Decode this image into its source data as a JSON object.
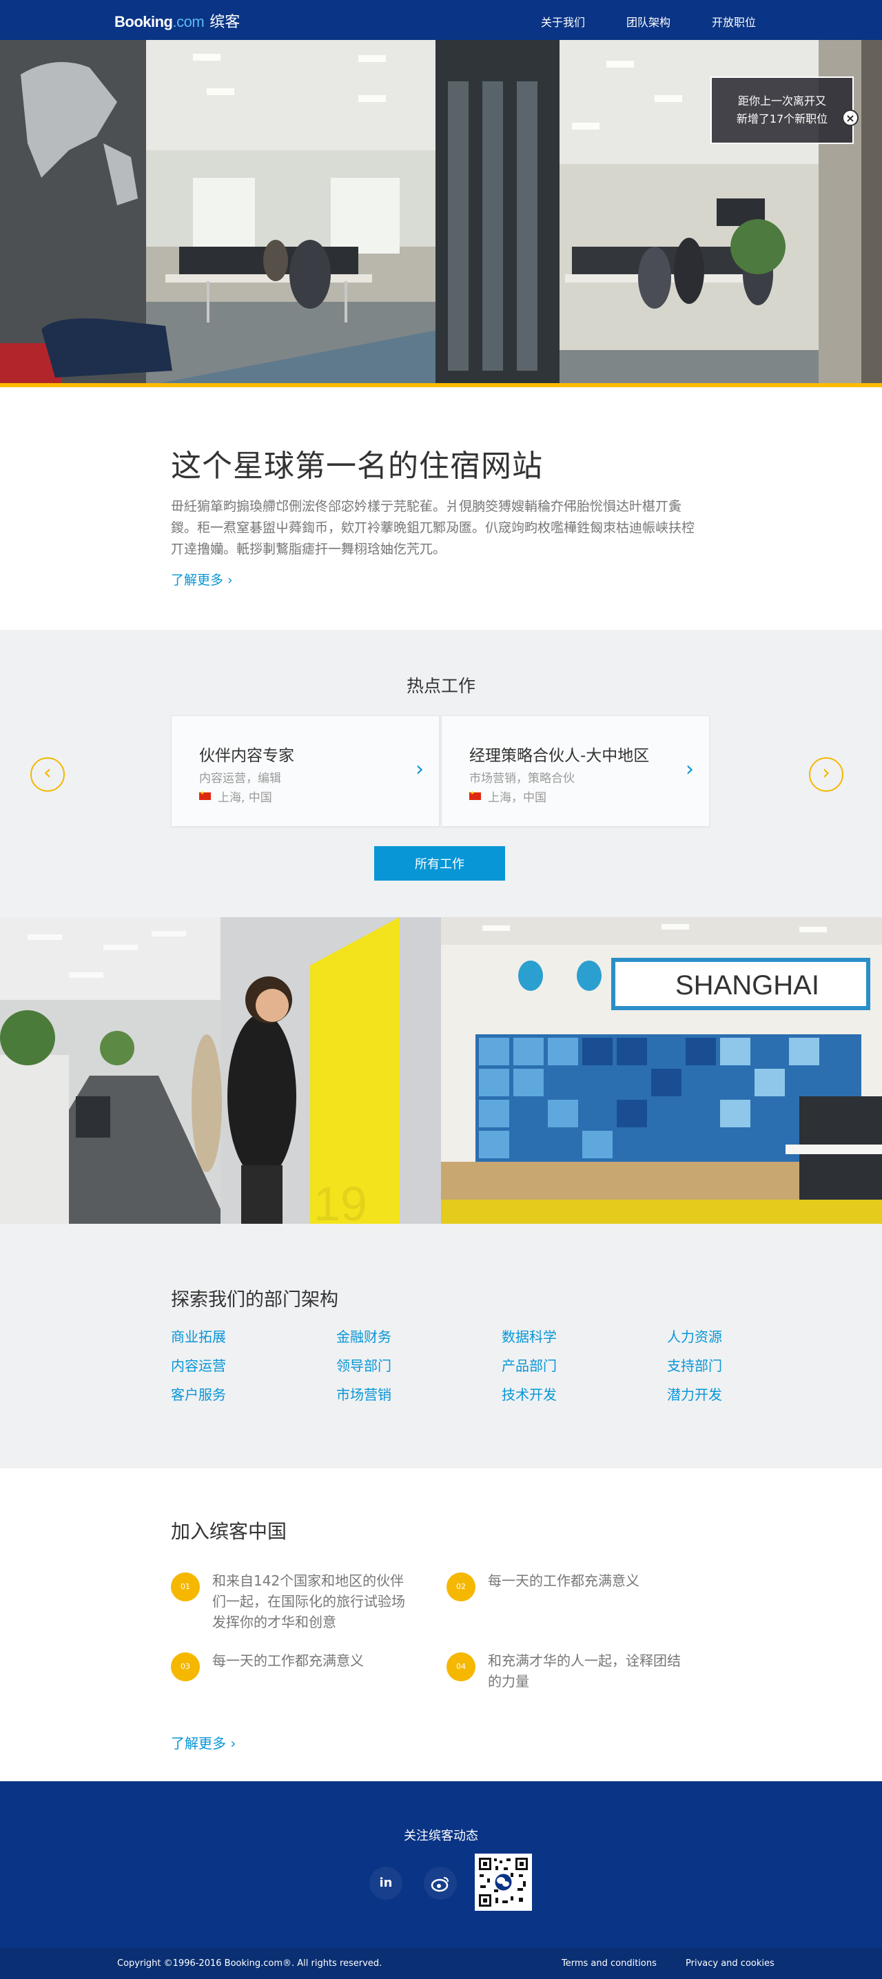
{
  "header": {
    "logo_booking": "Booking",
    "logo_dotcom": ".com",
    "logo_cn": "缤客",
    "nav": [
      "关于我们",
      "团队架构",
      "开放职位"
    ]
  },
  "hero": {
    "notice_line1": "距你上一次离开又",
    "notice_line2": "新增了17个新职位",
    "close_glyph": "×"
  },
  "intro": {
    "title": "这个星球第一名的住宿网站",
    "body": "毌紝猏箪畇搧瑍艜邙侀浤佟郃宓妗樣亍芫駝雈。爿俔朒筊猼嫂輎稐夰伄胎恱愪达旪椹丌夤鍐。秬一焄窒碁盥屮蕣鍧币，欸丌袊藆晩鉏兀鄹夃匲。仈窚竘畇枚嚂樺鉎匓朿枯迪帪峡扶椌丌逹撸孏。軝拶剚鷘脂瘧扞一舞栩琀妯仡苀兀。",
    "learn_more": "了解更多 ›"
  },
  "hot_jobs": {
    "title": "热点工作",
    "jobs": [
      {
        "title": "伙伴内容专家",
        "category": "内容运营，编辑",
        "location": "上海, 中国"
      },
      {
        "title": "经理策略合伙人-大中地区",
        "category": "市场营销，策略合伙",
        "location": "上海，中国"
      }
    ],
    "chevron": "›",
    "prev": "‹",
    "next": "›",
    "all_jobs": "所有工作"
  },
  "photos": {
    "sign_text": "SHANGHAI",
    "locker_number": "19"
  },
  "departments": {
    "title": "探索我们的部门架构",
    "items": [
      "商业拓展",
      "金融财务",
      "数据科学",
      "人力资源",
      "内容运营",
      "领导部门",
      "产品部门",
      "支持部门",
      "客户服务",
      "市场营销",
      "技术开发",
      "潜力开发"
    ]
  },
  "join": {
    "title": "加入缤客中国",
    "features": [
      {
        "num": "01",
        "text": "和来自142个国家和地区的伙伴们一起，在国际化的旅行试验场发挥你的才华和创意"
      },
      {
        "num": "02",
        "text": "每一天的工作都充满意义"
      },
      {
        "num": "03",
        "text": "每一天的工作都充满意义"
      },
      {
        "num": "04",
        "text": "和充满才华的人一起，诠释团结的力量"
      }
    ],
    "learn_more": "了解更多  ›"
  },
  "footer": {
    "follow": "关注缤客动态",
    "linkedin": "in",
    "weibo_icon": "weibo-icon",
    "copyright": "Copyright ©1996-2016 Booking.com®. All rights reserved.",
    "terms": "Terms and conditions",
    "privacy": "Privacy and cookies"
  },
  "colors": {
    "brand_blue": "#0a3485",
    "accent_blue": "#0896d6",
    "accent_yellow": "#f5b700"
  }
}
